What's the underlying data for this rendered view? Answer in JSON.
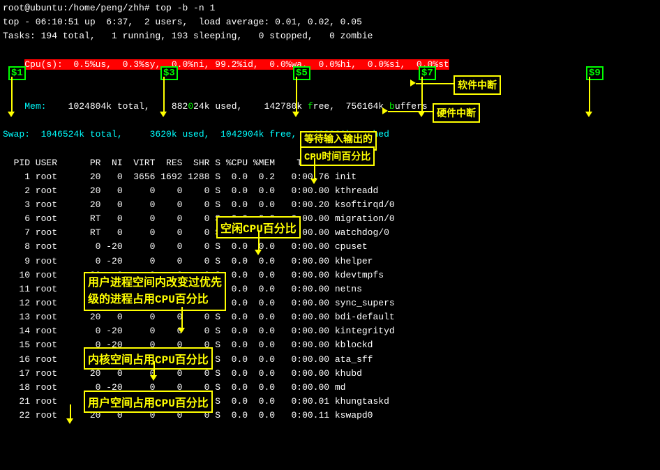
{
  "terminal": {
    "title": "root@ubuntu:/home/peng/zhh# top -b -n 1",
    "lines": {
      "cmd": "root@ubuntu:/home/peng/zhh# top -b -n 1",
      "time": "top - 06:10:51 up  6:37,  2 users,  load average: 0.01, 0.02, 0.05",
      "tasks": "Tasks: 194 total,   1 running, 193 sleeping,   0 stopped,   0 zombie",
      "cpu": "Cpu(s):  0.5%us,  0.3%sy,  0.0%ni, 99.2%id,  0.0%wa,  0.0%hi,  0.0%si,  0.0%st",
      "mem": "Mem:   1024804k total,   882024k used,   142780k free,    756164k buffers",
      "swap": "Swap:  1046524k total,     3620k used,  1042904k free,   482960k cached",
      "blank": "",
      "header": "  PID USER      PR  NI  VIRT  RES  SHR S %CPU %MEM    TIME+  COMMAND",
      "p1": "    1 root      20   0  3656 1692 1288 S  0.0  0.2   0:00.76 init",
      "p2": "    2 root      20   0     0    0    0 S  0.0  0.0   0:00.00 kthreadd",
      "p3": "    3 root      20   0     0    0    0 S  0.0  0.0   0:00.20 ksoftirqd/0",
      "p6": "    6 root      RT   0     0    0    0 S  0.0  0.0   0:00.00 migration/0",
      "p7": "    7 root      RT   0     0    0    0 S  0.0  0.0   0:00.00 watchdog/0",
      "p8": "    8 root       0 -20     0    0    0 S  0.0  0.0   0:00.00 cpuset",
      "p9": "    9 root       0 -20     0    0    0 S  0.0  0.0   0:00.00 khelper",
      "p10": "   10 root      20   0     0    0    0 S  0.0  0.0   0:00.00 kdevtmpfs",
      "p11": "   11 root       0 -20     0    0    0 S  0.0  0.0   0:00.00 netns",
      "p12": "   12 root      20   0     0    0    0 S  0.0  0.0   0:00.00 sync_supers",
      "p13": "   13 root      20   0     0    0    0 S  0.0  0.0   0:00.00 bdi-default",
      "p14": "   14 root       0 -20     0    0    0 S  0.0  0.0   0:00.00 kintegrityd",
      "p15": "   15 root       0 -20     0    0    0 S  0.0  0.0   0:00.00 kblockd",
      "p16": "   16 root       0 -20     0    0    0 S  0.0  0.0   0:00.00 ata_sff",
      "p17": "   17 root      20   0     0    0    0 S  0.0  0.0   0:00.00 khubd",
      "p18": "   18 root       0 -20     0    0    0 S  0.0  0.0   0:00.00 md",
      "p21": "   21 root      20   0     0    0    0 S  0.0  0.0   0:00.01 khungtaskd",
      "p22": "   22 root      20   0     0    0    0 S  0.0  0.0   0:00.11 kswapd0"
    },
    "annotations": {
      "dollar1": "$1",
      "dollar3": "$3",
      "dollar5": "$5",
      "dollar7": "$7",
      "dollar9": "$9",
      "ruanjian_zhongduan": "软件中断",
      "yinjian_zhongduan": "硬件中断",
      "dengdai_io": "等待输入输出的",
      "cpu_time": "CPU时间百分比",
      "kongxian_cpu": "空闲CPU百分比",
      "yonghu_neihe": "用户进程空间内改变过优先",
      "ji_cpu": "级的进程占用CPU百分比",
      "neihe_cpu": "内核空间占用CPU百分比",
      "yonghu_cpu": "用户空间占用CPU百分比"
    }
  }
}
